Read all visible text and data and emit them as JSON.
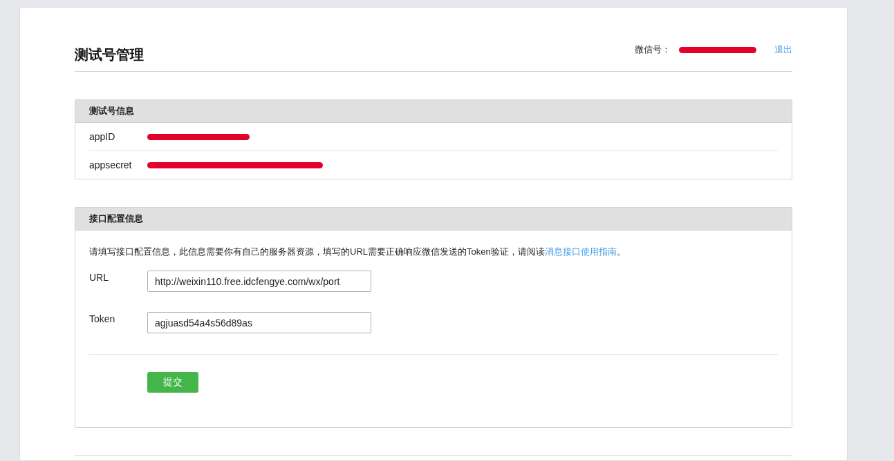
{
  "page": {
    "title": "测试号管理"
  },
  "account": {
    "label": "微信号：",
    "redacted": true,
    "logout_link": "退出"
  },
  "info_panel": {
    "title": "测试号信息",
    "rows": [
      {
        "label": "appID",
        "redacted": true
      },
      {
        "label": "appsecret",
        "redacted": true
      }
    ]
  },
  "config_panel": {
    "title": "接口配置信息",
    "description": "请填写接口配置信息，此信息需要你有自己的服务器资源，填写的URL需要正确响应微信发送的Token验证，请阅读",
    "guide_link": "消息接口使用指南",
    "description_end": "。",
    "fields": [
      {
        "label": "URL",
        "value": "http://weixin110.free.idcfengye.com/wx/port"
      },
      {
        "label": "Token",
        "value": "agjuasd54a4s56d89as"
      }
    ],
    "submit_button": "提交"
  }
}
